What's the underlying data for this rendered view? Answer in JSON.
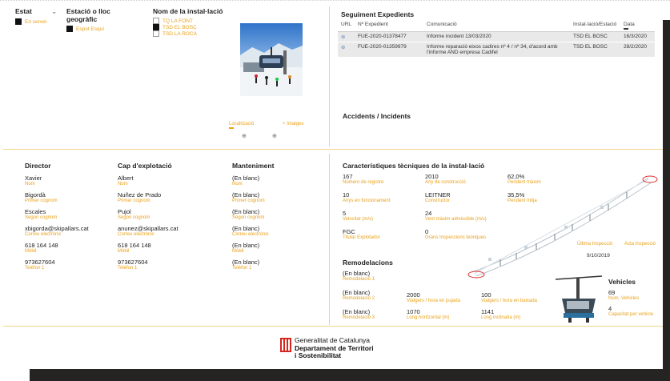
{
  "filters": {
    "estat": {
      "title": "Estat",
      "item": "En servei"
    },
    "estacio": {
      "title": "Estació o lloc geogràfic",
      "item": "Espot Esquí"
    },
    "installacio": {
      "title": "Nom de la instal·lació",
      "items": [
        "TQ LA FONT",
        "TSD EL BOSC",
        "TSD LA ROCA"
      ],
      "selected_index": 1
    }
  },
  "photo_links": {
    "localitzacio": "Localització",
    "imatges": "+ Imatges"
  },
  "seguiment": {
    "title": "Seguiment Expedients",
    "columns": [
      "URL",
      "Nº Expedient",
      "Comunicació",
      "Instal·lació/Estació",
      "Data"
    ],
    "rows": [
      {
        "expedient": "FUE-2020-01378477",
        "comunicacio": "Informe incident 13/03/2020",
        "installacio": "TSD EL BOSC",
        "data": "16/3/2020"
      },
      {
        "expedient": "FUE-2020-01359979",
        "comunicacio": "Informe reparació eixos cadires nº 4 / nº 34, d'acord amb l'informe AND empresa Cadifel",
        "installacio": "TSD EL BOSC",
        "data": "28/2/2020"
      }
    ]
  },
  "accidents": {
    "title": "Accidents / Incidents"
  },
  "director": {
    "title": "Director",
    "fields": [
      {
        "value": "Xavier",
        "label": "Nom"
      },
      {
        "value": "Bigordà",
        "label": "Primer cognom"
      },
      {
        "value": "Escales",
        "label": "Segon cognom"
      },
      {
        "value": "xbigorda@skipallars.cat",
        "label": "Correu electrònic"
      },
      {
        "value": "618 164 148",
        "label": "Mòbil"
      },
      {
        "value": "973627604",
        "label": "Telèfon 1"
      }
    ]
  },
  "cap": {
    "title": "Cap d'explotació",
    "fields": [
      {
        "value": "Albert",
        "label": "Nom"
      },
      {
        "value": "Nuñez de Prado",
        "label": "Primer cognom"
      },
      {
        "value": "Pujol",
        "label": "Segon cognom"
      },
      {
        "value": "anunez@skipallars.cat",
        "label": "Correu electrònic"
      },
      {
        "value": "618 164 148",
        "label": "Mòbil"
      },
      {
        "value": "973627604",
        "label": "Telèfon 1"
      }
    ]
  },
  "manteniment": {
    "title": "Manteniment",
    "fields": [
      {
        "value": "(En blanc)",
        "label": "Nom"
      },
      {
        "value": "(En blanc)",
        "label": "Primer cognom"
      },
      {
        "value": "(En blanc)",
        "label": "Segon cognom"
      },
      {
        "value": "(En blanc)",
        "label": "Correu electrònic"
      },
      {
        "value": "(En blanc)",
        "label": "Mòbil"
      },
      {
        "value": "(En blanc)",
        "label": "Telèfon 1"
      }
    ]
  },
  "caracteristiques": {
    "title": "Característiques tècniques de la instal·lació",
    "col1": [
      {
        "value": "167",
        "label": "Número de registre"
      },
      {
        "value": "10",
        "label": "Anys en funcionament"
      },
      {
        "value": "5",
        "label": "Velocitat (m/s)"
      },
      {
        "value": "FGC",
        "label": "Titular Explotador"
      }
    ],
    "col2": [
      {
        "value": "2010",
        "label": "Any de construcció"
      },
      {
        "value": "LEITNER",
        "label": "Constructor"
      },
      {
        "value": "24",
        "label": "Vent màxim admissible (m/s)"
      },
      {
        "value": "0",
        "label": "Grans Inspeccions teòriques"
      }
    ],
    "col3": [
      {
        "value": "62,0%",
        "label": "Pendent màxim"
      },
      {
        "value": "35,5%",
        "label": "Pendent mitja"
      }
    ],
    "ultima_inspeccio_label": "Última Inspecció",
    "acta_inspeccio_label": "Acta Inspecció",
    "inspeccio_data": "9/10/2019"
  },
  "remodelacions": {
    "title": "Remodelacions",
    "items": [
      {
        "value": "(En blanc)",
        "label": "Remodelació 1"
      },
      {
        "value": "(En blanc)",
        "label": "Remodelació 2"
      },
      {
        "value": "(En blanc)",
        "label": "Remodelació 3"
      }
    ],
    "stats": [
      {
        "value": "2000",
        "label": "Viatgers / hora en pujada"
      },
      {
        "value": "100",
        "label": "Viatgers / hora en baixada"
      },
      {
        "value": "1070",
        "label": "Long horitzontal (m)"
      },
      {
        "value": "1141",
        "label": "Long inclinada (m)"
      }
    ]
  },
  "vehicles": {
    "title": "Vehicles",
    "fields": [
      {
        "value": "69",
        "label": "Núm. Vehicles"
      },
      {
        "value": "4",
        "label": "Capacitat per vehicle"
      }
    ]
  },
  "footer": {
    "line1": "Generalitat de Catalunya",
    "line2": "Departament de Territori",
    "line3": "i Sostenibilitat"
  },
  "colors": {
    "accent": "#e9a21c",
    "dark": "#252423"
  }
}
